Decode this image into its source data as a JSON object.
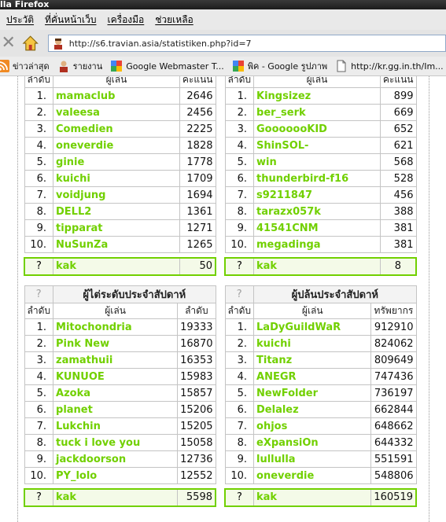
{
  "window": {
    "title": "lla Firefox"
  },
  "menu": [
    "ประวัติ",
    "ที่คั่นหน้าเว็บ",
    "เครื่องมือ",
    "ช่วยเหลือ"
  ],
  "nav": {
    "url": "http://s6.travian.asia/statistiken.php?id=7"
  },
  "bookmarks": [
    {
      "icon": "rss-icon",
      "label": "ข่าวล่าสุด"
    },
    {
      "icon": "person-icon",
      "label": "รายงาน"
    },
    {
      "icon": "google-icon",
      "label": "Google Webmaster T..."
    },
    {
      "icon": "google-icon",
      "label": "พิค - Google รูปภาพ"
    },
    {
      "icon": "page-icon",
      "label": "http://kr.gg.in.th/Im..."
    }
  ],
  "tables": {
    "top_left": {
      "headers": [
        "ลำดับ",
        "ผู้เล่น",
        "คะแนน"
      ],
      "rows": [
        [
          "1.",
          "mamaclub",
          "2646"
        ],
        [
          "2.",
          "valeesa",
          "2456"
        ],
        [
          "3.",
          "Comedien",
          "2225"
        ],
        [
          "4.",
          "oneverdie",
          "1828"
        ],
        [
          "5.",
          "ginie",
          "1778"
        ],
        [
          "6.",
          "kuichi",
          "1709"
        ],
        [
          "7.",
          "voidjung",
          "1694"
        ],
        [
          "8.",
          "DELL2",
          "1361"
        ],
        [
          "9.",
          "tipparat",
          "1271"
        ],
        [
          "10.",
          "NuSunZa",
          "1265"
        ]
      ],
      "own": [
        "?",
        "kak",
        "50"
      ]
    },
    "top_right": {
      "headers": [
        "ลำดับ",
        "ผู้เล่น",
        "คะแนน"
      ],
      "rows": [
        [
          "1.",
          "Kingsizez",
          "899"
        ],
        [
          "2.",
          "ber_serk",
          "669"
        ],
        [
          "3.",
          "GooooooKID",
          "652"
        ],
        [
          "4.",
          "ShinSOL-",
          "621"
        ],
        [
          "5.",
          "win",
          "568"
        ],
        [
          "6.",
          "thunderbird-f16",
          "528"
        ],
        [
          "7.",
          "s9211847",
          "456"
        ],
        [
          "8.",
          "tarazx057k",
          "388"
        ],
        [
          "9.",
          "41541CNM",
          "381"
        ],
        [
          "10.",
          "megadinga",
          "381"
        ]
      ],
      "own": [
        "?",
        "kak",
        "8"
      ]
    },
    "bottom_left": {
      "title_q": "?",
      "title": "ผู้ไต่ระดับประจำสัปดาห์",
      "headers": [
        "ลำดับ",
        "ผู้เล่น",
        "ลำดับ"
      ],
      "rows": [
        [
          "1.",
          "Mitochondria",
          "19333"
        ],
        [
          "2.",
          "Pink New",
          "16870"
        ],
        [
          "3.",
          "zamathuii",
          "16353"
        ],
        [
          "4.",
          "KUNUOE",
          "15983"
        ],
        [
          "5.",
          "Azoka",
          "15857"
        ],
        [
          "6.",
          "planet",
          "15206"
        ],
        [
          "7.",
          "Lukchin",
          "15205"
        ],
        [
          "8.",
          "tuck i love you",
          "15058"
        ],
        [
          "9.",
          "jackdoorson",
          "12736"
        ],
        [
          "10.",
          "PY_lolo",
          "12552"
        ]
      ],
      "own": [
        "?",
        "kak",
        "5598"
      ]
    },
    "bottom_right": {
      "title_q": "?",
      "title": "ผู้ปล้นประจำสัปดาห์",
      "headers": [
        "ลำดับ",
        "ผู้เล่น",
        "ทรัพยากร"
      ],
      "rows": [
        [
          "1.",
          "LaDyGuildWaR",
          "912910"
        ],
        [
          "2.",
          "kuichi",
          "824062"
        ],
        [
          "3.",
          "Titanz",
          "809649"
        ],
        [
          "4.",
          "ANEGR",
          "747436"
        ],
        [
          "5.",
          "NewFolder",
          "736197"
        ],
        [
          "6.",
          "Delalez",
          "662844"
        ],
        [
          "7.",
          "ohjos",
          "648662"
        ],
        [
          "8.",
          "eXpansiOn",
          "644332"
        ],
        [
          "9.",
          "lullulla",
          "551591"
        ],
        [
          "10.",
          "oneverdie",
          "548806"
        ]
      ],
      "own": [
        "?",
        "kak",
        "160519"
      ]
    }
  }
}
